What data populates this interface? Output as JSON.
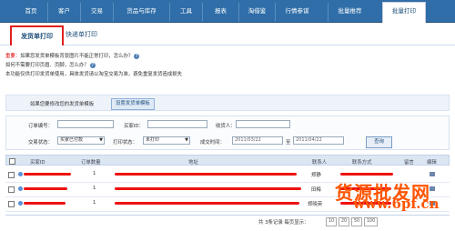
{
  "topnav": {
    "tabs": [
      "首页",
      "客户",
      "交易",
      "货品与库存",
      "工具",
      "报表",
      "淘借鉴",
      "行情参谋",
      "批量推荐",
      "批量打印"
    ]
  },
  "subtabs": {
    "active": "发货单打印",
    "other": "快递单打印"
  },
  "notice": {
    "label": "重要：",
    "line1": "如果您发货单模板背景图片不能正常打印，怎么办？",
    "line2": "如何不需要打印页眉、页脚，怎么办？",
    "line3": "本功能仅供打印发货单使用，具体发货请以淘宝交易为准，避免重复发货造成损失"
  },
  "template": {
    "text": "如果您要修改您的发货单模板",
    "button": "设置发货单模板"
  },
  "filter": {
    "order_no_label": "订单编号：",
    "buyer_id_label": "买家ID：",
    "receiver_label": "收货人：",
    "status_label": "交易状态：",
    "status_value": "买家已付款",
    "print_status_label": "打印状态：",
    "print_status_value": "未打印",
    "time_label": "成交时间：",
    "date_from": "2011/03/22",
    "date_sep": "至",
    "date_to": "2011/04/22",
    "search_button": "查询"
  },
  "table": {
    "headers": [
      "买家ID",
      "订单数量",
      "地址",
      "联系人",
      "联系方式",
      "留言",
      "编辑"
    ],
    "rows": [
      {
        "qty": "1",
        "contact": "郑静"
      },
      {
        "qty": "1",
        "contact": "田梅"
      },
      {
        "qty": "1",
        "contact": "郑晓英"
      }
    ]
  },
  "footer": {
    "summary": "共 3条记录  每页显示：",
    "pages": [
      "10",
      "20",
      "50",
      "100"
    ]
  },
  "watermark": {
    "line1": "货源批发网",
    "line2": "www.6pf.cn"
  },
  "colors": {
    "nav": "#2f6ea8",
    "highlight": "#e02020",
    "mask": "#e11111",
    "watermark": "#ff5500"
  }
}
